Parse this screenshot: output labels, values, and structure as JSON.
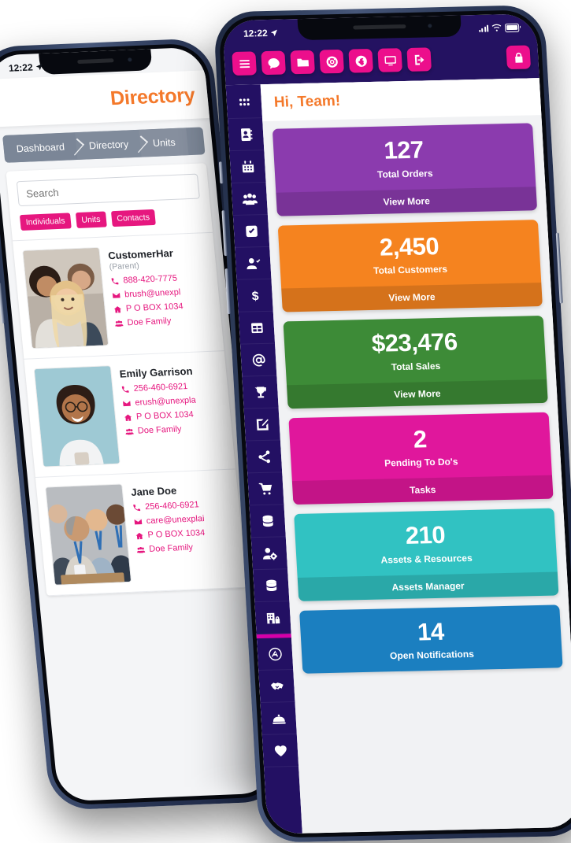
{
  "scene": {
    "background_color": "#ffffff",
    "phone_frame_color": "#2b3857"
  },
  "left_phone": {
    "status_bar": {
      "time": "12:22",
      "location_icon": "location-arrow-icon"
    },
    "header": {
      "title": "Directory",
      "title_color": "#f4792b"
    },
    "breadcrumb": {
      "items": [
        "Dashboard",
        "Directory",
        "Units"
      ]
    },
    "search": {
      "placeholder": "Search",
      "value": ""
    },
    "filter_chips": [
      {
        "label": "Individuals"
      },
      {
        "label": "Units"
      },
      {
        "label": "Contacts"
      }
    ],
    "chip_color": "#e6177f",
    "contacts": [
      {
        "name": "CustomerHar",
        "role": "(Parent)",
        "phone": "888-420-7775",
        "email": "brush@unexpl",
        "address": "P O BOX 1034",
        "family": "Doe Family",
        "photo_alt": "group-selfie-three-friends"
      },
      {
        "name": "Emily Garrison",
        "role": "",
        "phone": "256-460-6921",
        "email": "erush@unexpla",
        "address": "P O BOX 1034",
        "family": "Doe Family",
        "photo_alt": "woman-with-glasses-holding-phone"
      },
      {
        "name": "Jane Doe",
        "role": "",
        "phone": "256-460-6921",
        "email": "care@unexplai",
        "address": "P O BOX 1034",
        "family": "Doe Family",
        "photo_alt": "team-of-volunteers-with-badges"
      }
    ]
  },
  "right_phone": {
    "status_bar": {
      "time": "12:22",
      "location_icon": "location-arrow-icon"
    },
    "top_nav": {
      "background": "#241261",
      "button_color": "#ec0f8c",
      "items": [
        {
          "icon": "hamburger-menu-icon",
          "label": "Menu"
        },
        {
          "icon": "chat-bubble-icon",
          "label": "Messages"
        },
        {
          "icon": "folder-icon",
          "label": "Files"
        },
        {
          "icon": "life-ring-icon",
          "label": "Support"
        },
        {
          "icon": "globe-icon",
          "label": "Web"
        },
        {
          "icon": "desktop-monitor-icon",
          "label": "Desktop"
        },
        {
          "icon": "sign-out-icon",
          "label": "Sign Out"
        },
        {
          "icon": "lock-icon",
          "label": "Lock"
        }
      ]
    },
    "sidebar": {
      "background": "#231063",
      "divider_color": "#d600a8",
      "items": [
        {
          "icon": "apps-grid-icon",
          "label": "Apps"
        },
        {
          "icon": "address-book-icon",
          "label": "Directory"
        },
        {
          "icon": "calendar-icon",
          "label": "Calendar"
        },
        {
          "icon": "users-group-icon",
          "label": "Groups"
        },
        {
          "icon": "check-square-icon",
          "label": "Tasks"
        },
        {
          "icon": "user-check-icon",
          "label": "Attendance"
        },
        {
          "icon": "dollar-sign-icon",
          "label": "Finance"
        },
        {
          "icon": "table-grid-icon",
          "label": "Reports"
        },
        {
          "icon": "at-sign-icon",
          "label": "Email"
        },
        {
          "icon": "trophy-icon",
          "label": "Awards"
        },
        {
          "icon": "edit-square-icon",
          "label": "Forms"
        },
        {
          "icon": "share-nodes-icon",
          "label": "Share"
        },
        {
          "icon": "shopping-cart-icon",
          "label": "Store"
        },
        {
          "icon": "database-icon",
          "label": "Data"
        },
        {
          "icon": "user-gear-icon",
          "label": "Admin"
        },
        {
          "icon": "database-icon",
          "label": "Records"
        },
        {
          "icon": "building-lock-icon",
          "label": "Facilities"
        },
        {
          "icon": "app-store-circle-icon",
          "label": "App Store"
        },
        {
          "icon": "handshake-icon",
          "label": "Partners"
        },
        {
          "icon": "concierge-bell-icon",
          "label": "Services"
        },
        {
          "icon": "heart-icon",
          "label": "Favorites"
        }
      ]
    },
    "greeting": {
      "text": "Hi, Team!",
      "color": "#f4792b"
    },
    "cards": [
      {
        "value": "127",
        "label": "Total Orders",
        "action": "View More",
        "color": "#8b3bae"
      },
      {
        "value": "2,450",
        "label": "Total Customers",
        "action": "View More",
        "color": "#f5831f"
      },
      {
        "value": "$23,476",
        "label": "Total Sales",
        "action": "View More",
        "color": "#3d8b37"
      },
      {
        "value": "2",
        "label": "Pending To Do's",
        "action": "Tasks",
        "color": "#e0179c"
      },
      {
        "value": "210",
        "label": "Assets & Resources",
        "action": "Assets Manager",
        "color": "#31c2c2"
      },
      {
        "value": "14",
        "label": "Open Notifications",
        "action": "",
        "color": "#1b7fc0"
      }
    ]
  }
}
